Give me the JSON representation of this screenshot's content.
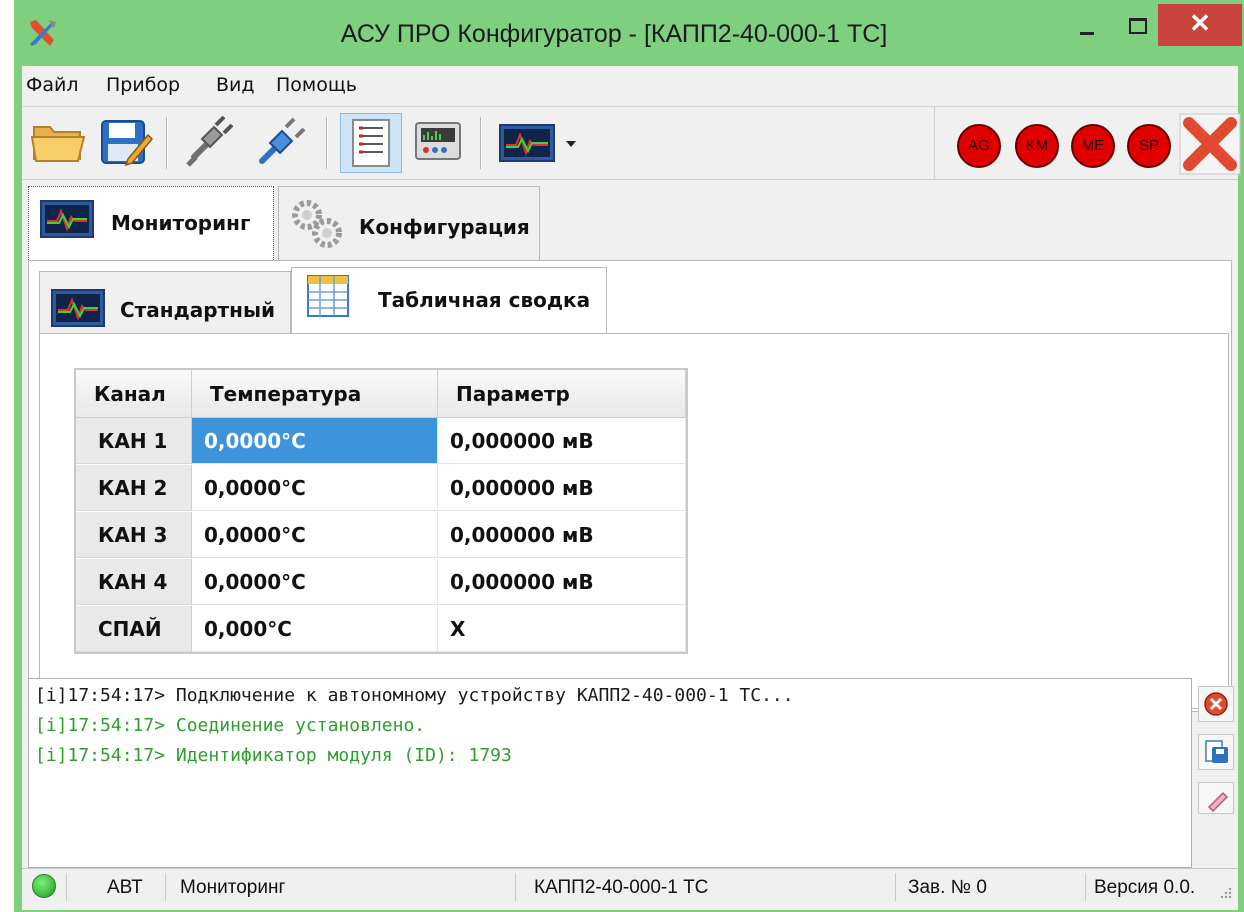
{
  "window": {
    "title": "АСУ ПРО Конфигуратор - [КАПП2-40-000-1 ТС]",
    "close_glyph": "✕"
  },
  "menu": [
    "Файл",
    "Прибор",
    "Вид",
    "Помощь"
  ],
  "toolbar": {
    "buttons": [
      "open-folder-icon",
      "save-icon",
      "disconnect-icon",
      "connect-icon",
      "table-report-icon",
      "device-panel-icon",
      "monitor-chart-icon"
    ],
    "indicators": [
      "AG",
      "KM",
      "ME",
      "SP"
    ],
    "indicator_color": "#e10000"
  },
  "tabs": {
    "main": [
      "Мониторинг",
      "Конфигурация"
    ],
    "sub": [
      "Стандартный",
      "Табличная сводка"
    ]
  },
  "table": {
    "headers": [
      "Канал",
      "Температура",
      "Параметр"
    ],
    "rows": [
      {
        "channel": "КАН 1",
        "temperature": "0,0000°C",
        "parameter": "0,000000 мВ"
      },
      {
        "channel": "КАН 2",
        "temperature": "0,0000°C",
        "parameter": "0,000000 мВ"
      },
      {
        "channel": "КАН 3",
        "temperature": "0,0000°C",
        "parameter": "0,000000 мВ"
      },
      {
        "channel": "КАН 4",
        "temperature": "0,0000°C",
        "parameter": "0,000000 мВ"
      },
      {
        "channel": "СПАЙ",
        "temperature": "0,000°C",
        "parameter": "X"
      }
    ],
    "selection_color": "#3d94db"
  },
  "log": [
    {
      "text": "[i]17:54:17> Подключение к автономному устройству КАПП2-40-000-1 ТС...",
      "color": "#1a1a1a"
    },
    {
      "text": "[i]17:54:17> Соединение установлено.",
      "color": "#2e9e2e"
    },
    {
      "text": "[i]17:54:17> Идентификатор модуля (ID): 1793",
      "color": "#2e9e2e"
    }
  ],
  "log_buttons": [
    "clear-log-icon",
    "save-log-icon",
    "erase-icon"
  ],
  "status": {
    "mode": "АВТ",
    "state": "Мониторинг",
    "device": "КАПП2-40-000-1 ТС",
    "serial": "Зав. № 0",
    "version": "Версия 0.0."
  },
  "colors": {
    "title_bar": "#7ed07e",
    "close_button": "#c9443b"
  }
}
